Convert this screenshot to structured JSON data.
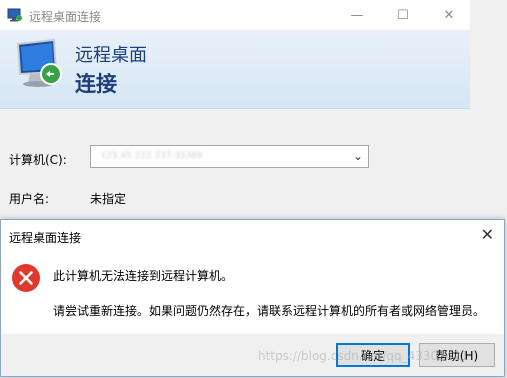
{
  "window": {
    "title": "远程桌面连接",
    "icon": "remote-desktop-icon",
    "controls": {
      "minimize": "—",
      "maximize": "☐",
      "close": "✕"
    }
  },
  "header": {
    "line1": "远程桌面",
    "line2": "连接",
    "icon": "monitor-connection-icon"
  },
  "form": {
    "computer_label": "计算机(C):",
    "computer_value": "123.45.222.237:33389",
    "username_label": "用户名:",
    "username_value": "未指定"
  },
  "dialog": {
    "title": "远程桌面连接",
    "close": "✕",
    "icon": "error-icon",
    "message_main": "此计算机无法连接到远程计算机。",
    "message_detail": "请尝试重新连接。如果问题仍然存在，请联系远程计算机的所有者或网络管理员。",
    "ok_label": "确定",
    "help_label": "帮助(H)"
  },
  "watermark": "https://blog.csdn.net/qq_43302421",
  "colors": {
    "header_text": "#1c3f7c",
    "error_red": "#e0392b",
    "focus_border": "#0078d7"
  }
}
